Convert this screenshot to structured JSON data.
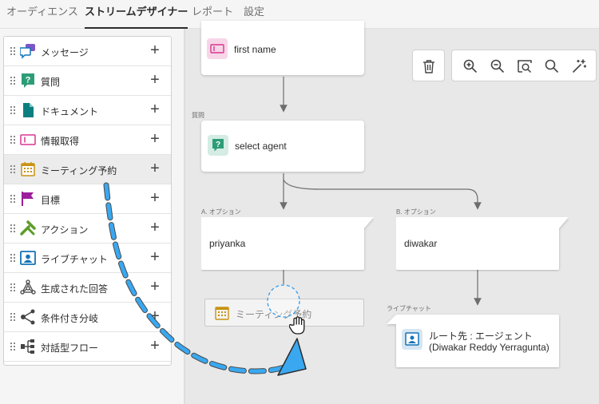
{
  "tabs": [
    {
      "label": "オーディエンス"
    },
    {
      "label": "ストリームデザイナー"
    },
    {
      "label": "レポート"
    },
    {
      "label": "設定"
    }
  ],
  "sidebar": {
    "items": [
      {
        "label": "メッセージ",
        "icon": "message-icon"
      },
      {
        "label": "質問",
        "icon": "question-icon"
      },
      {
        "label": "ドキュメント",
        "icon": "document-icon"
      },
      {
        "label": "情報取得",
        "icon": "info-capture-icon"
      },
      {
        "label": "ミーティング予約",
        "icon": "calendar-icon"
      },
      {
        "label": "目標",
        "icon": "flag-icon"
      },
      {
        "label": "アクション",
        "icon": "action-icon"
      },
      {
        "label": "ライブチャット",
        "icon": "live-chat-icon"
      },
      {
        "label": "生成された回答",
        "icon": "generated-answer-icon"
      },
      {
        "label": "条件付き分岐",
        "icon": "branch-icon"
      },
      {
        "label": "対話型フロー",
        "icon": "flow-icon"
      }
    ],
    "plus": "+"
  },
  "canvas": {
    "node_first_name": {
      "label": "first name"
    },
    "node_select_agent": {
      "caption": "質問",
      "label": "select agent"
    },
    "node_priyanka": {
      "caption": "A. オプション",
      "label": "priyanka"
    },
    "node_diwakar": {
      "caption": "B. オプション",
      "label": "diwakar"
    },
    "node_live_chat": {
      "caption": "ライブチャット",
      "line1": "ルート先 : エージェント",
      "line2": "(Diwakar Reddy Yerragunta)"
    },
    "drag_ghost": {
      "label": "ミーティング予約"
    }
  },
  "toolbar": {
    "tools": [
      "trash-icon",
      "zoom-in-icon",
      "zoom-out-icon",
      "zoom-fit-icon",
      "search-icon",
      "magic-wand-icon"
    ]
  },
  "colors": {
    "accent_blue": "#2d9cf0",
    "question_green": "#2d9d78",
    "document_teal": "#0b7f80",
    "calendar_yellow": "#c99212",
    "info_pink": "#d83790",
    "flag_purple": "#9b1d9b",
    "action_green": "#5c9c2a",
    "livechat_blue": "#1473b8"
  }
}
